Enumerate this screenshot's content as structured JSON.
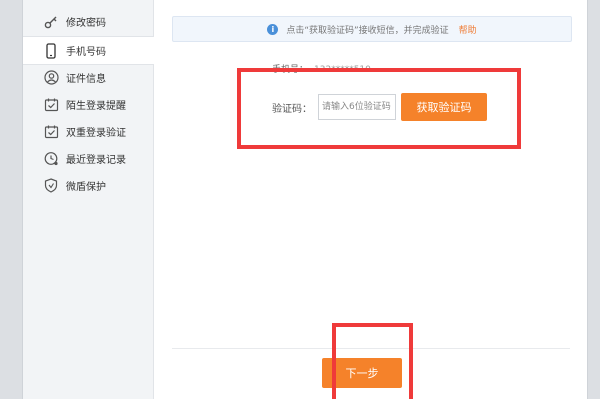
{
  "sidebar": {
    "items": [
      {
        "label": "修改密码",
        "icon": "key-icon"
      },
      {
        "label": "手机号码",
        "icon": "phone-icon"
      },
      {
        "label": "证件信息",
        "icon": "user-icon"
      },
      {
        "label": "陌生登录提醒",
        "icon": "calendar-check-icon"
      },
      {
        "label": "双重登录验证",
        "icon": "calendar-check-icon"
      },
      {
        "label": "最近登录记录",
        "icon": "clock-icon"
      },
      {
        "label": "微盾保护",
        "icon": "shield-icon"
      }
    ]
  },
  "notice": {
    "text": "点击“获取验证码”接收短信，并完成验证",
    "help": "帮助"
  },
  "form": {
    "phone_label": "手机号：",
    "phone_value": "132*****510",
    "code_label": "验证码：",
    "code_placeholder": "请输入6位验证码",
    "get_code_label": "获取验证码"
  },
  "footer": {
    "next_label": "下一步"
  },
  "colors": {
    "accent": "#f5822a",
    "annotation": "#ef3a3a",
    "info": "#4a90d9"
  }
}
